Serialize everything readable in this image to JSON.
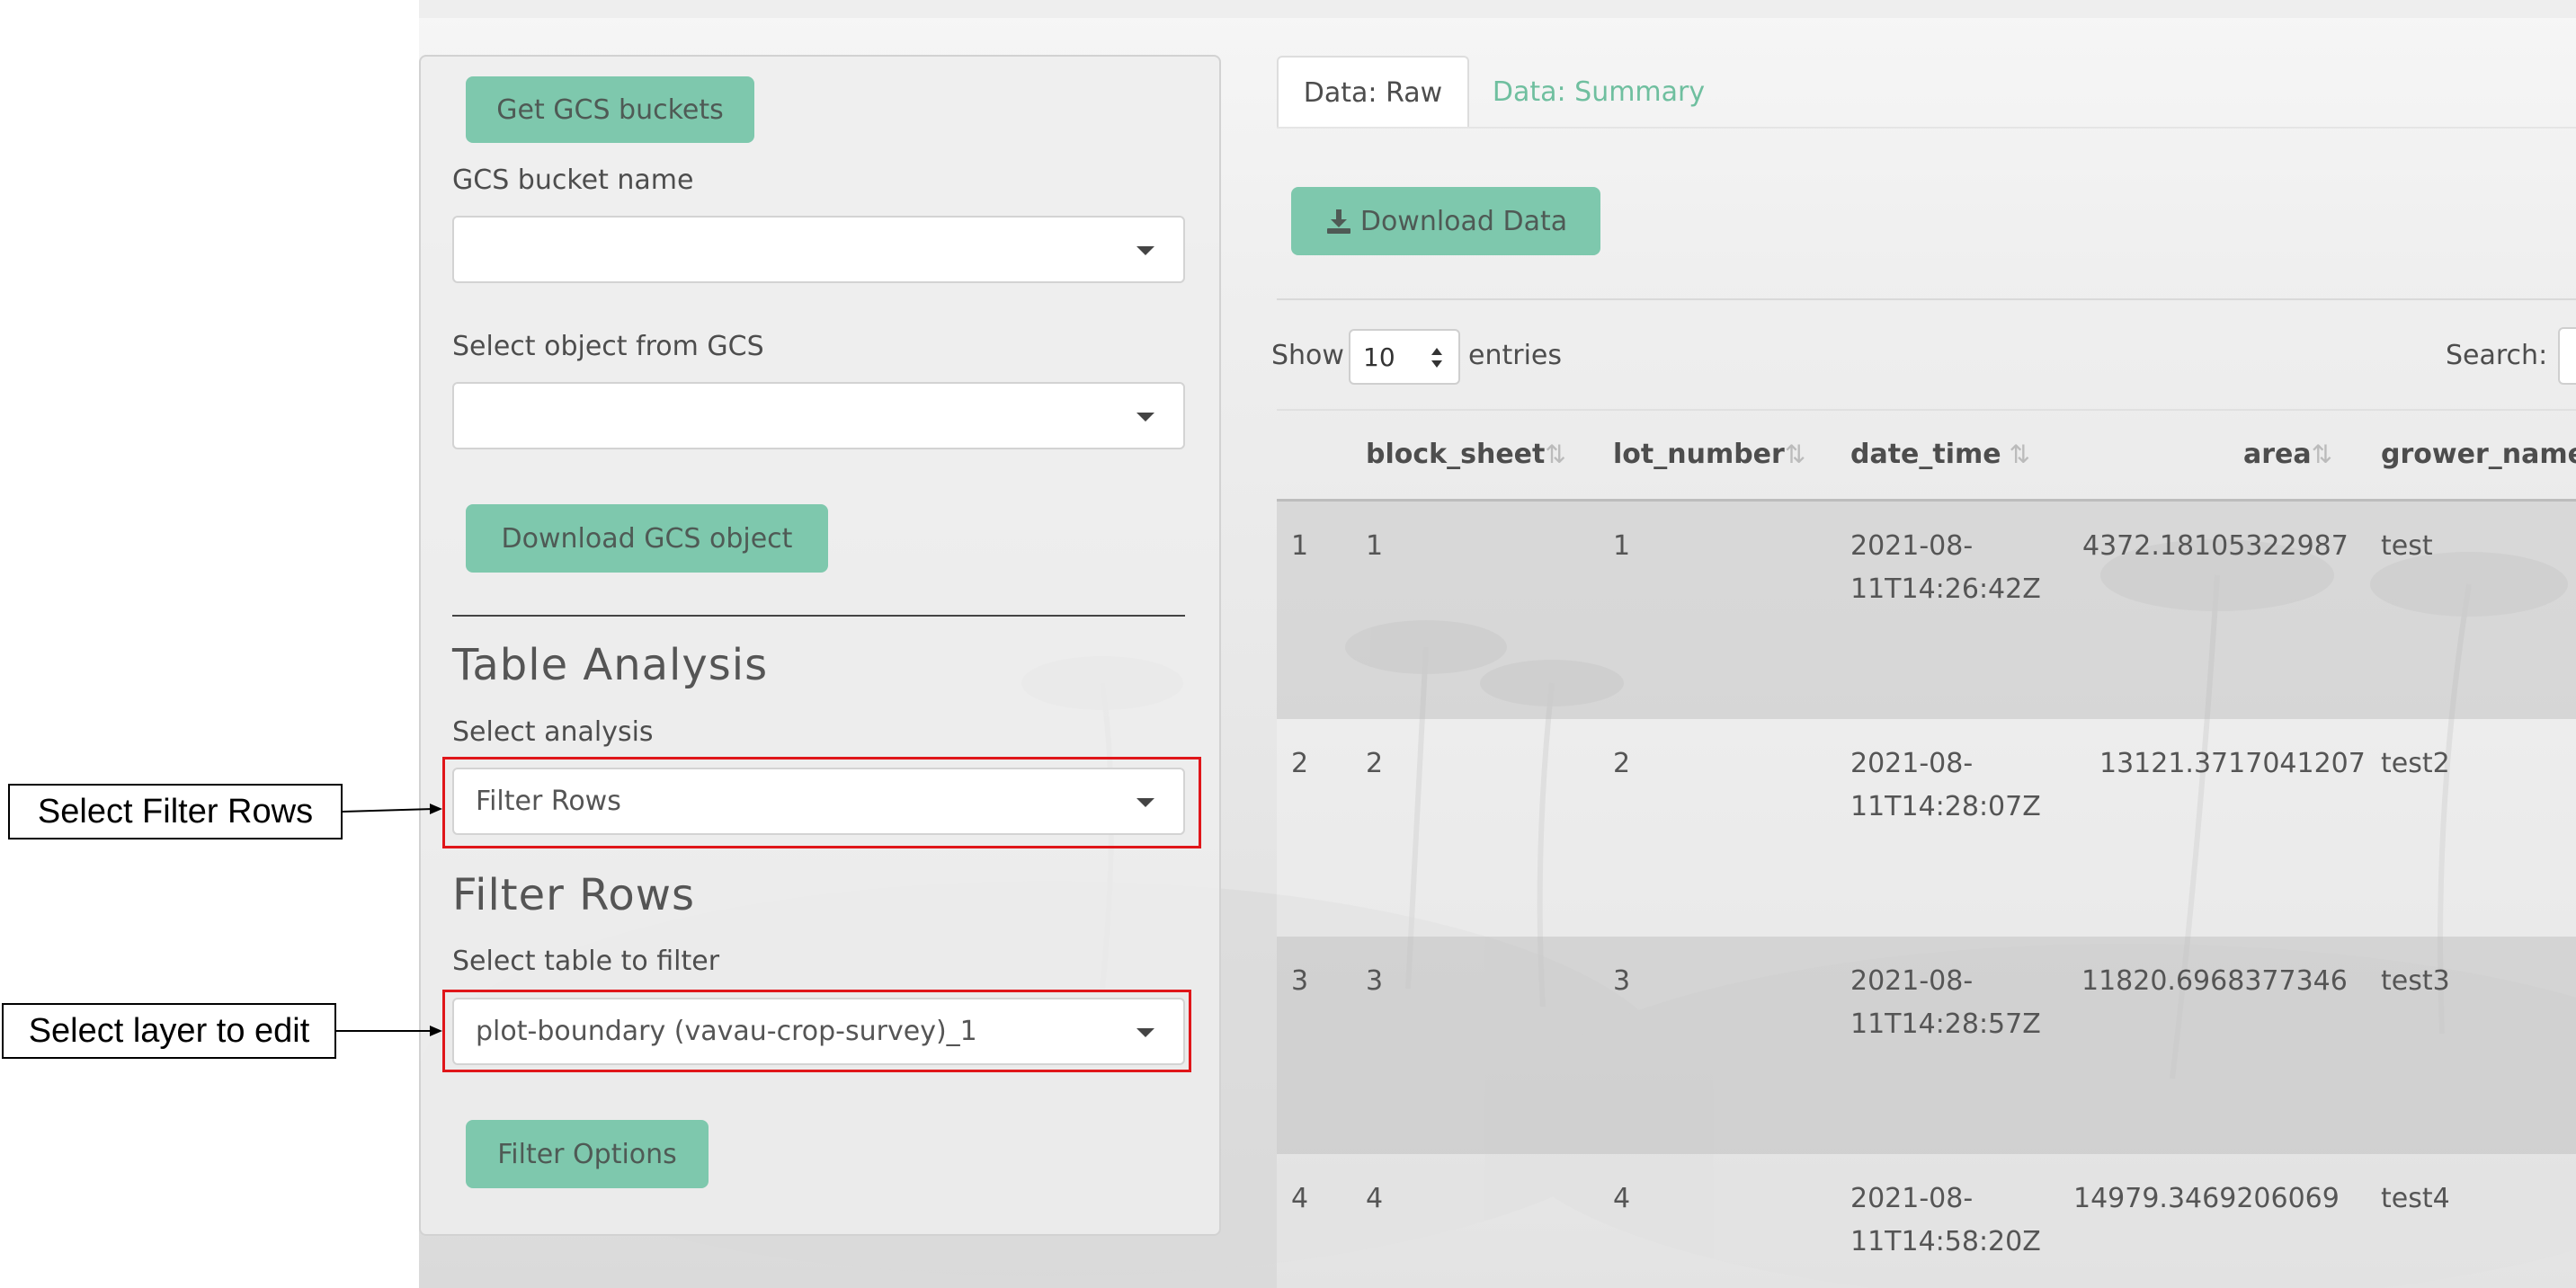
{
  "sidebar": {
    "get_buckets_button": "Get GCS buckets",
    "bucket_label": "GCS bucket name",
    "bucket_value": "",
    "object_label": "Select object from GCS",
    "object_value": "",
    "download_object_button": "Download GCS object",
    "table_analysis_heading": "Table Analysis",
    "select_analysis_label": "Select analysis",
    "select_analysis_value": "Filter Rows",
    "filter_rows_heading": "Filter Rows",
    "select_table_label": "Select table to filter",
    "select_table_value": "plot-boundary (vavau-crop-survey)_1",
    "filter_options_button": "Filter Options"
  },
  "callouts": {
    "filter_rows": "Select Filter Rows",
    "layer_edit": "Select layer to edit"
  },
  "main": {
    "tabs": [
      {
        "label": "Data: Raw"
      },
      {
        "label": "Data: Summary"
      }
    ],
    "download_button": "Download Data",
    "show_label": "Show",
    "entries_value": "10",
    "entries_label": "entries",
    "search_label": "Search:"
  },
  "table": {
    "columns": [
      "block_sheet",
      "lot_number",
      "date_time",
      "area",
      "grower_name"
    ],
    "rows": [
      {
        "idx": "1",
        "block_sheet": "1",
        "lot_number": "1",
        "date_line1": "2021-08-",
        "date_line2": "11T14:26:42Z",
        "area": "4372.18105322987",
        "grower_name": "test"
      },
      {
        "idx": "2",
        "block_sheet": "2",
        "lot_number": "2",
        "date_line1": "2021-08-",
        "date_line2": "11T14:28:07Z",
        "area": "13121.3717041207",
        "grower_name": "test2"
      },
      {
        "idx": "3",
        "block_sheet": "3",
        "lot_number": "3",
        "date_line1": "2021-08-",
        "date_line2": "11T14:28:57Z",
        "area": "11820.6968377346",
        "grower_name": "test3"
      },
      {
        "idx": "4",
        "block_sheet": "4",
        "lot_number": "4",
        "date_line1": "2021-08-",
        "date_line2": "11T14:58:20Z",
        "area": "14979.3469206069",
        "grower_name": "test4"
      }
    ]
  },
  "colors": {
    "accent": "#7ec8ad",
    "tab_link": "#6fbf9f",
    "highlight_box": "#e0161a"
  },
  "icons": [
    "download-icon",
    "caret-down-icon",
    "sort-icon"
  ]
}
